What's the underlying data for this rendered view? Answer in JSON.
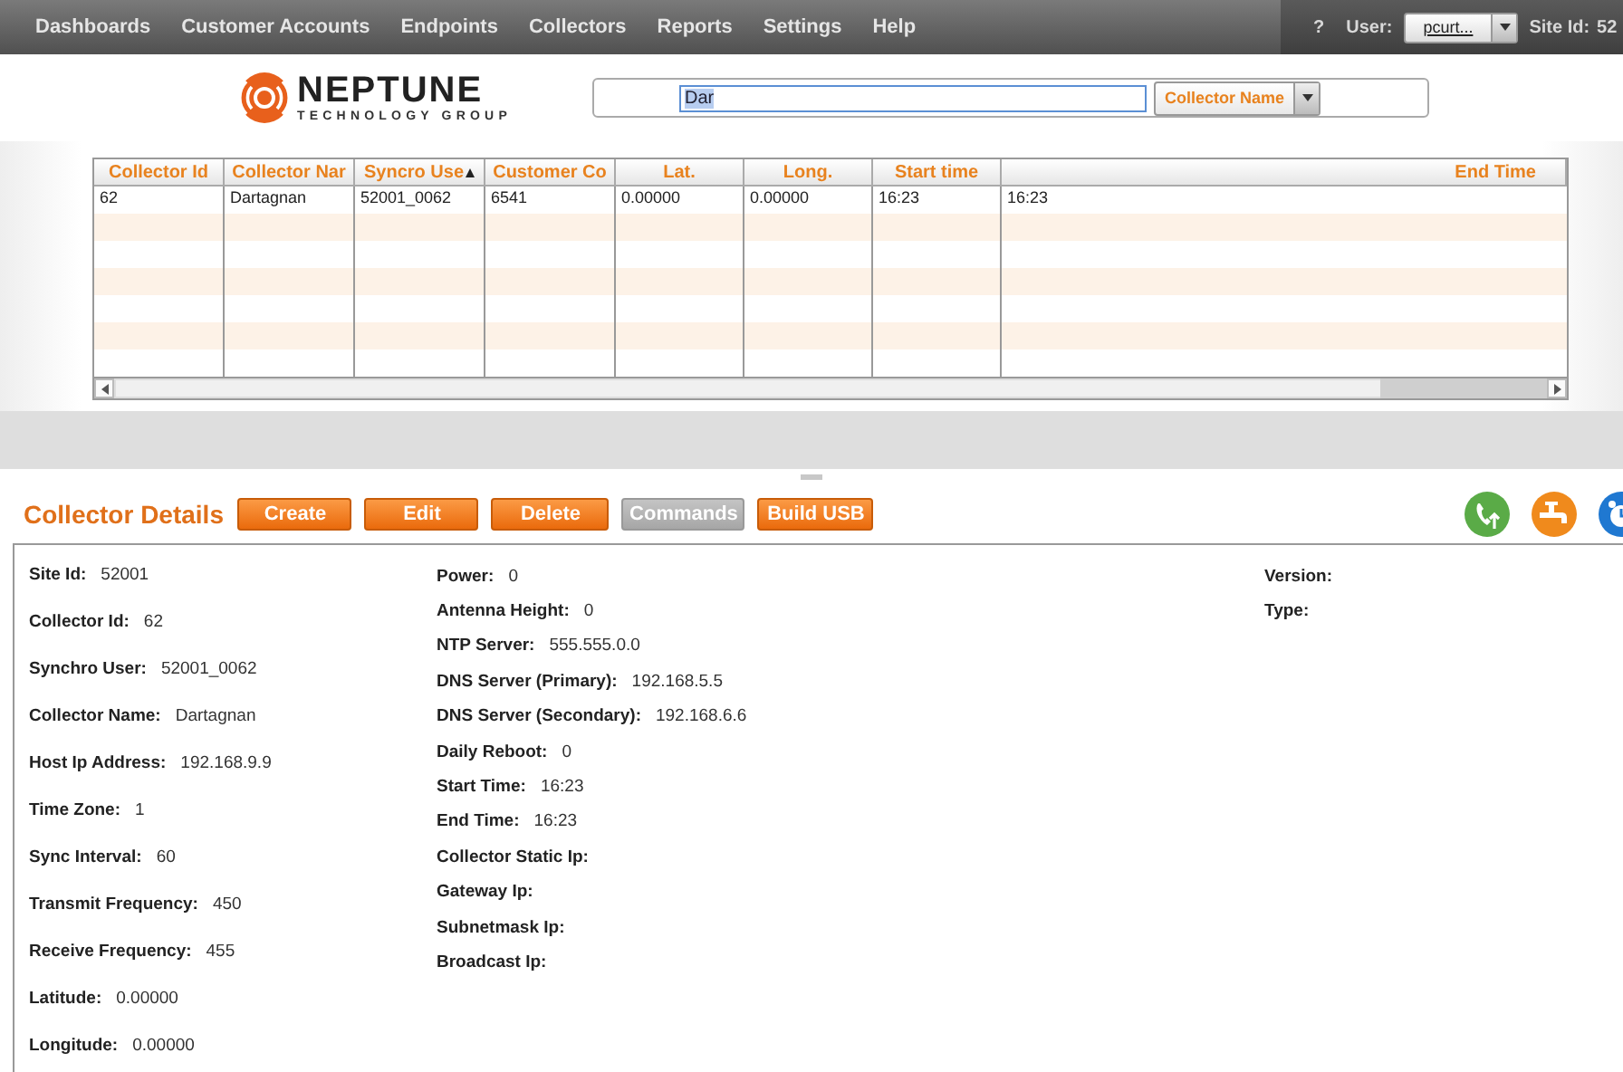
{
  "nav": {
    "items": [
      "Dashboards",
      "Customer Accounts",
      "Endpoints",
      "Collectors",
      "Reports",
      "Settings",
      "Help"
    ],
    "help": "?",
    "user_label": "User:",
    "user_value": "pcurt...",
    "site_label": "Site Id:",
    "site_value": "52"
  },
  "logo": {
    "name": "NEPTUNE",
    "tagline": "TECHNOLOGY GROUP"
  },
  "search": {
    "value": "Dar",
    "value_selected": true,
    "filter": "Collector Name"
  },
  "table": {
    "columns": [
      {
        "label": "Collector Id",
        "sorted": false
      },
      {
        "label": "Collector Nar",
        "sorted": false
      },
      {
        "label": "Syncro Use",
        "sorted": true
      },
      {
        "label": "Customer Co",
        "sorted": false
      },
      {
        "label": "Lat.",
        "sorted": false
      },
      {
        "label": "Long.",
        "sorted": false
      },
      {
        "label": "Start time",
        "sorted": false
      },
      {
        "label": "End Time",
        "sorted": false
      }
    ],
    "rows": [
      [
        "62",
        "Dartagnan",
        "52001_0062",
        "6541",
        "0.00000",
        "0.00000",
        "16:23",
        "16:23"
      ]
    ]
  },
  "details": {
    "title": "Collector Details",
    "buttons": [
      {
        "label": "Create",
        "disabled": false
      },
      {
        "label": "Edit",
        "disabled": false
      },
      {
        "label": "Delete",
        "disabled": false
      },
      {
        "label": "Commands",
        "disabled": true
      },
      {
        "label": "Build USB",
        "disabled": false
      }
    ],
    "columns": [
      [
        {
          "label": "Site Id:",
          "value": "52001"
        },
        {
          "label": "Collector Id:",
          "value": "62"
        },
        {
          "label": "Synchro User:",
          "value": "52001_0062"
        },
        {
          "label": "Collector Name:",
          "value": "Dartagnan"
        },
        {
          "label": "Host Ip Address:",
          "value": "192.168.9.9"
        },
        {
          "label": "Time Zone:",
          "value": "1"
        },
        {
          "label": "Sync Interval:",
          "value": "60"
        },
        {
          "label": "Transmit Frequency:",
          "value": "450"
        },
        {
          "label": "Receive Frequency:",
          "value": "455"
        },
        {
          "label": "Latitude:",
          "value": "0.00000"
        },
        {
          "label": "Longitude:",
          "value": "0.00000"
        }
      ],
      [
        {
          "label": "Power:",
          "value": "0"
        },
        {
          "label": "Antenna Height:",
          "value": "0"
        },
        {
          "label": "NTP Server:",
          "value": "555.555.0.0"
        },
        {
          "label": "DNS Server (Primary):",
          "value": "192.168.5.5"
        },
        {
          "label": "DNS Server (Secondary):",
          "value": "192.168.6.6"
        },
        {
          "label": "Daily Reboot:",
          "value": "0"
        },
        {
          "label": "Start Time:",
          "value": "16:23"
        },
        {
          "label": "End Time:",
          "value": "16:23"
        },
        {
          "label": "Collector Static Ip:"
        },
        {
          "label": "Gateway Ip:"
        },
        {
          "label": "Subnetmask Ip:"
        },
        {
          "label": "Broadcast Ip:"
        }
      ],
      [
        {
          "label": "Version:"
        },
        {
          "label": "Type:"
        }
      ]
    ]
  }
}
